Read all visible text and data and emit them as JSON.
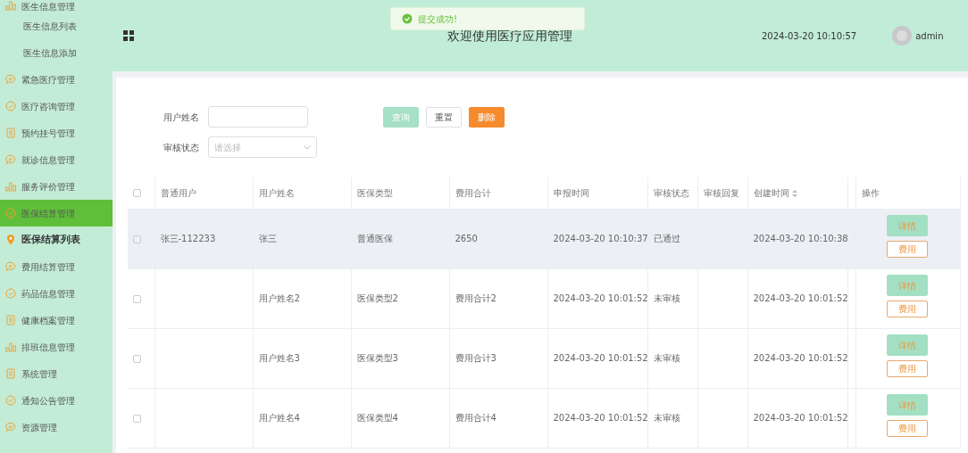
{
  "sidebar": {
    "items": [
      {
        "label": "医生信息管理",
        "kind": "bars",
        "selected": false
      },
      {
        "label": "医生信息列表",
        "kind": "sub",
        "selected": false
      },
      {
        "label": "医生信息添加",
        "kind": "sub",
        "selected": false
      },
      {
        "label": "紧急医疗管理",
        "kind": "chat",
        "selected": false
      },
      {
        "label": "医疗咨询管理",
        "kind": "check",
        "selected": false
      },
      {
        "label": "预约挂号管理",
        "kind": "doc",
        "selected": false
      },
      {
        "label": "就诊信息管理",
        "kind": "chat",
        "selected": false
      },
      {
        "label": "服务评价管理",
        "kind": "bars",
        "selected": false
      },
      {
        "label": "医保结算管理",
        "kind": "check",
        "selected": true
      },
      {
        "label": "医保结算列表",
        "kind": "pin",
        "selected": false
      },
      {
        "label": "费用结算管理",
        "kind": "chat",
        "selected": false
      },
      {
        "label": "药品信息管理",
        "kind": "check",
        "selected": false
      },
      {
        "label": "健康档案管理",
        "kind": "doc",
        "selected": false
      },
      {
        "label": "排班信息管理",
        "kind": "bars",
        "selected": false
      },
      {
        "label": "系统管理",
        "kind": "doc",
        "selected": false
      },
      {
        "label": "通知公告管理",
        "kind": "check",
        "selected": false
      },
      {
        "label": "资源管理",
        "kind": "chat",
        "selected": false
      }
    ]
  },
  "header": {
    "title": "欢迎使用医疗应用管理",
    "datetime": "2024-03-20 10:10:57",
    "user": "admin"
  },
  "toast": {
    "message": "提交成功!"
  },
  "filters": [
    {
      "label": "用户姓名",
      "kind": "input"
    },
    {
      "label": "审核状态",
      "kind": "select",
      "placeholder": "请选择"
    }
  ],
  "buttons": [
    {
      "label": "查询",
      "kind": "query"
    },
    {
      "label": "重置",
      "kind": "reset"
    },
    {
      "label": "删除",
      "kind": "delete"
    }
  ],
  "table": {
    "all_checked": false,
    "columns": [
      "普通用户",
      "用户姓名",
      "医保类型",
      "费用合计",
      "申报时间",
      "审核状态",
      "审核回复",
      "创建时间",
      "操作"
    ],
    "rows": [
      {
        "checked": false,
        "highlighted": true,
        "cells": [
          "张三-112233",
          "张三",
          "普通医保",
          "2650",
          "2024-03-20 10:10:37",
          "已通过",
          "",
          "2024-03-20 10:10:38"
        ],
        "actions": [
          "详情",
          "费用"
        ]
      },
      {
        "checked": false,
        "highlighted": false,
        "cells": [
          "",
          "用户姓名2",
          "医保类型2",
          "费用合计2",
          "2024-03-20 10:01:52",
          "未审核",
          "",
          "2024-03-20 10:01:52"
        ],
        "actions": [
          "详情",
          "费用"
        ]
      },
      {
        "checked": false,
        "highlighted": false,
        "cells": [
          "",
          "用户姓名3",
          "医保类型3",
          "费用合计3",
          "2024-03-20 10:01:52",
          "未审核",
          "",
          "2024-03-20 10:01:52"
        ],
        "actions": [
          "详情",
          "费用"
        ]
      },
      {
        "checked": false,
        "highlighted": false,
        "cells": [
          "",
          "用户姓名4",
          "医保类型4",
          "费用合计4",
          "2024-03-20 10:01:52",
          "未审核",
          "",
          "2024-03-20 10:01:52"
        ],
        "actions": [
          "详情",
          "费用"
        ]
      }
    ]
  }
}
